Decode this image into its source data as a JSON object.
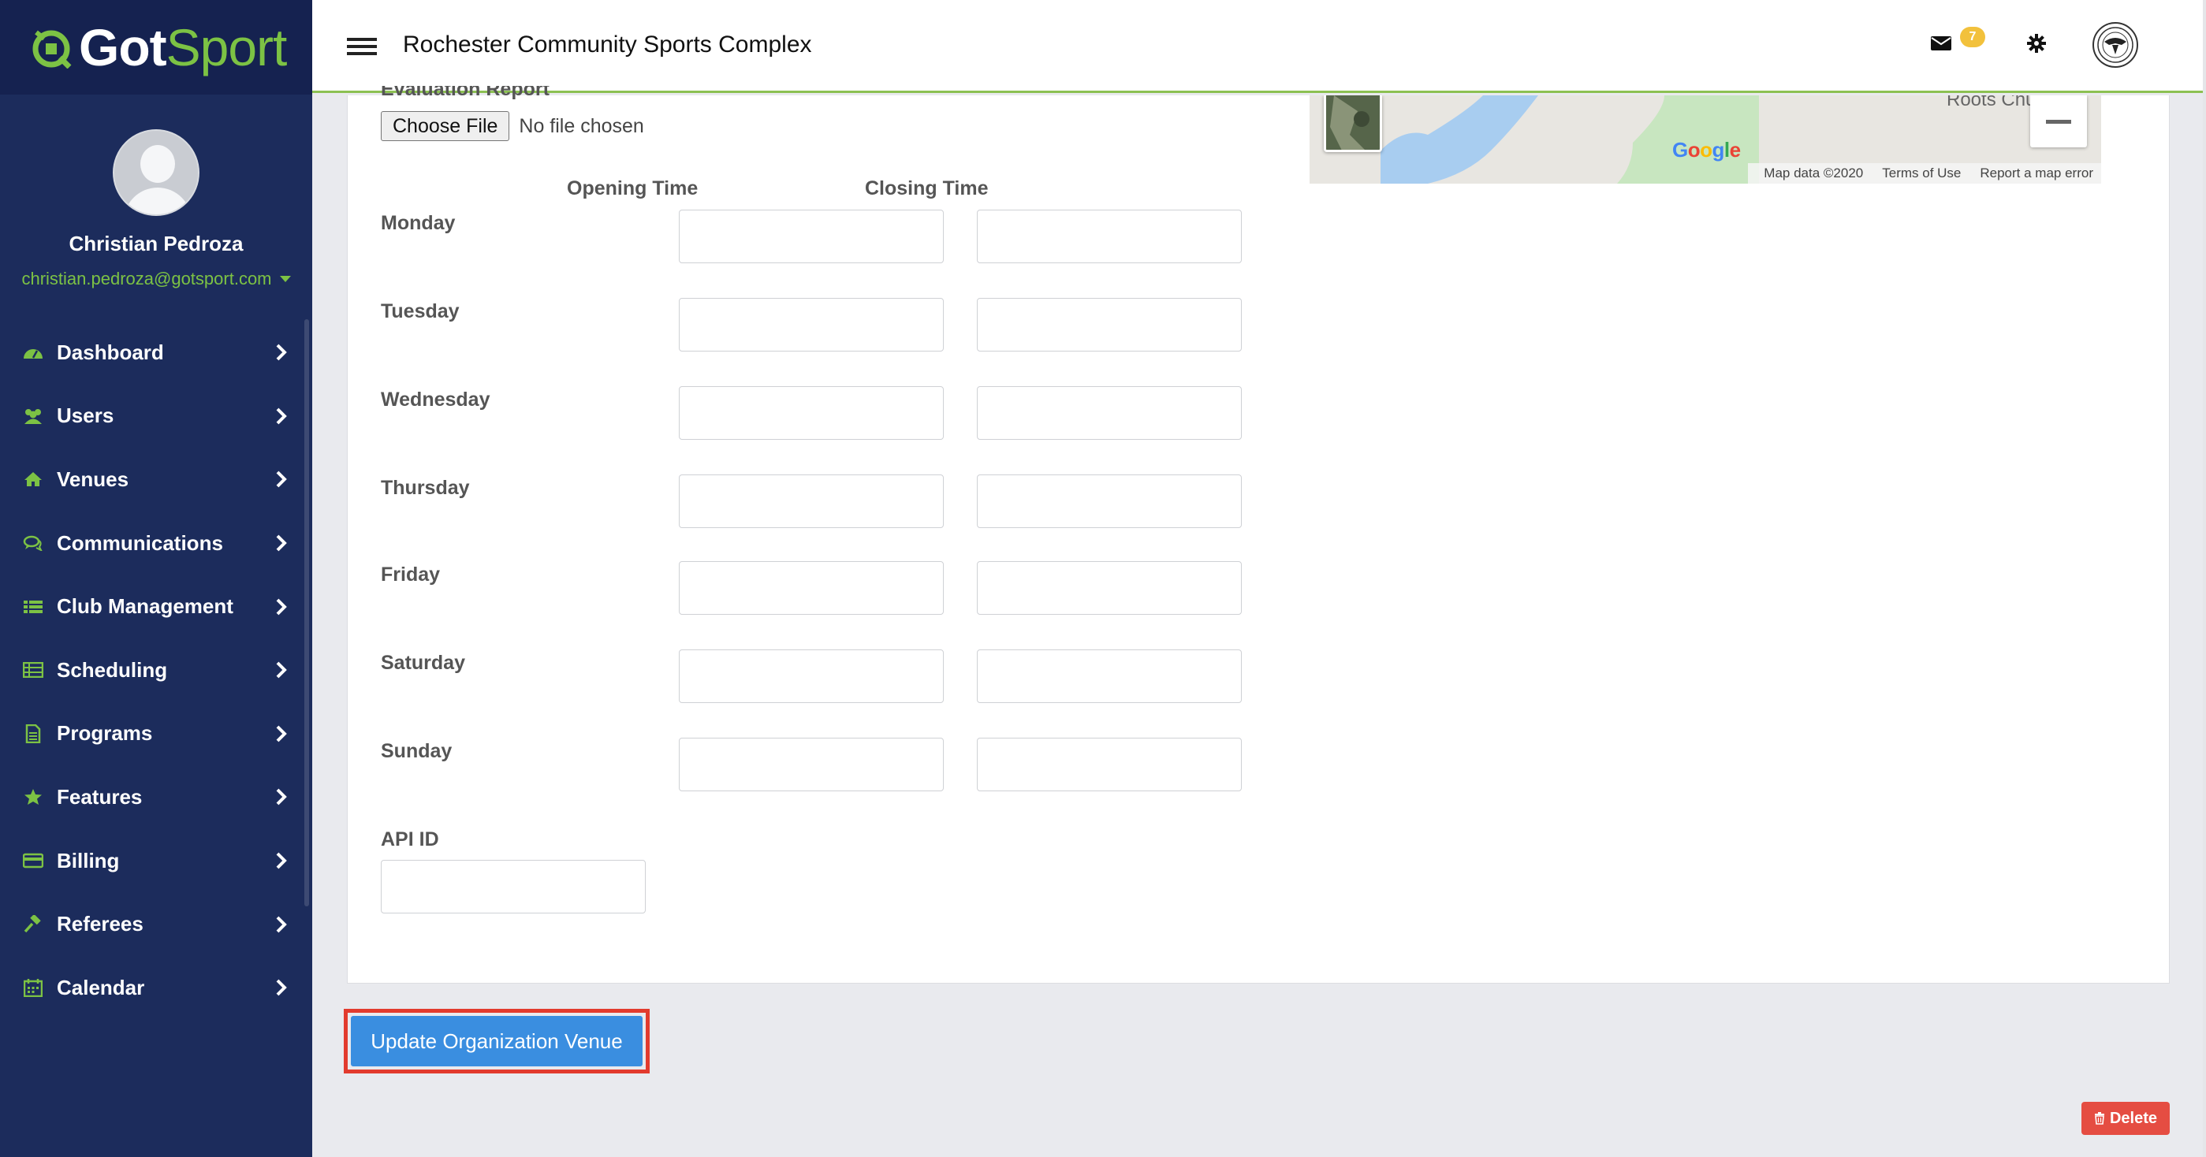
{
  "brand": {
    "logo_text_1": "Got",
    "logo_text_2": "Sport",
    "accent": "#7cc244",
    "sidebar_bg": "#1c2c5c"
  },
  "user": {
    "name": "Christian Pedroza",
    "email": "christian.pedroza@gotsport.com"
  },
  "sidebar": {
    "items": [
      {
        "label": "Dashboard",
        "icon": "dashboard-icon"
      },
      {
        "label": "Users",
        "icon": "users-icon"
      },
      {
        "label": "Venues",
        "icon": "home-icon"
      },
      {
        "label": "Communications",
        "icon": "comments-icon"
      },
      {
        "label": "Club Management",
        "icon": "list-icon"
      },
      {
        "label": "Scheduling",
        "icon": "table-icon"
      },
      {
        "label": "Programs",
        "icon": "file-icon"
      },
      {
        "label": "Features",
        "icon": "star-icon"
      },
      {
        "label": "Billing",
        "icon": "credit-card-icon"
      },
      {
        "label": "Referees",
        "icon": "gavel-icon"
      },
      {
        "label": "Calendar",
        "icon": "calendar-icon"
      }
    ]
  },
  "header": {
    "title": "Rochester Community Sports Complex",
    "message_count": "7"
  },
  "form": {
    "evaluation_report_label": "Evaluation Report",
    "choose_file_label": "Choose File",
    "file_status": "No file chosen",
    "opening_time_label": "Opening Time",
    "closing_time_label": "Closing Time",
    "days": [
      {
        "name": "Monday",
        "open": "",
        "close": ""
      },
      {
        "name": "Tuesday",
        "open": "",
        "close": ""
      },
      {
        "name": "Wednesday",
        "open": "",
        "close": ""
      },
      {
        "name": "Thursday",
        "open": "",
        "close": ""
      },
      {
        "name": "Friday",
        "open": "",
        "close": ""
      },
      {
        "name": "Saturday",
        "open": "",
        "close": ""
      },
      {
        "name": "Sunday",
        "open": "",
        "close": ""
      }
    ],
    "api_id_label": "API ID",
    "api_id_value": ""
  },
  "map": {
    "place_label": "Roots Chu",
    "google_logo": "Google",
    "attribution": "Map data ©2020",
    "terms": "Terms of Use",
    "report": "Report a map error"
  },
  "actions": {
    "update_label": "Update Organization Venue",
    "delete_label": "Delete"
  }
}
